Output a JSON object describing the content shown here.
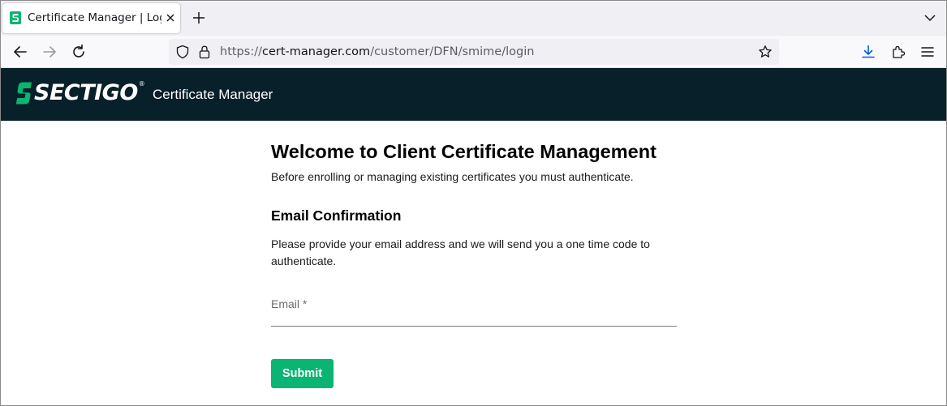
{
  "browser": {
    "tab": {
      "title": "Certificate Manager | Login"
    },
    "address": {
      "prefix": "https://",
      "host": "cert-manager.com",
      "path": "/customer/DFN/smime/login"
    },
    "icons": {
      "favicon": "sectigo-s-icon",
      "back": "arrow-left-icon",
      "forward": "arrow-right-icon",
      "reload": "reload-icon",
      "shield": "shield-icon",
      "lock": "lock-icon",
      "bookmark": "star-icon",
      "downloads": "download-icon",
      "extensions": "puzzle-icon",
      "menu": "hamburger-icon"
    },
    "colors": {
      "accent": "#0060df"
    }
  },
  "header": {
    "brand": "SECTIGO",
    "brand_mark": "®",
    "app_title": "Certificate Manager",
    "colors": {
      "background": "#07202a",
      "logo_green": "#0ab472"
    }
  },
  "main": {
    "title": "Welcome to Client Certificate Management",
    "intro": "Before enrolling or managing existing certificates you must authenticate.",
    "section_title": "Email Confirmation",
    "section_description": "Please provide your email address and we will send you a one time code to authenticate.",
    "email": {
      "label": "Email *",
      "value": ""
    },
    "submit_label": "Submit",
    "colors": {
      "submit": "#0ab472"
    }
  }
}
